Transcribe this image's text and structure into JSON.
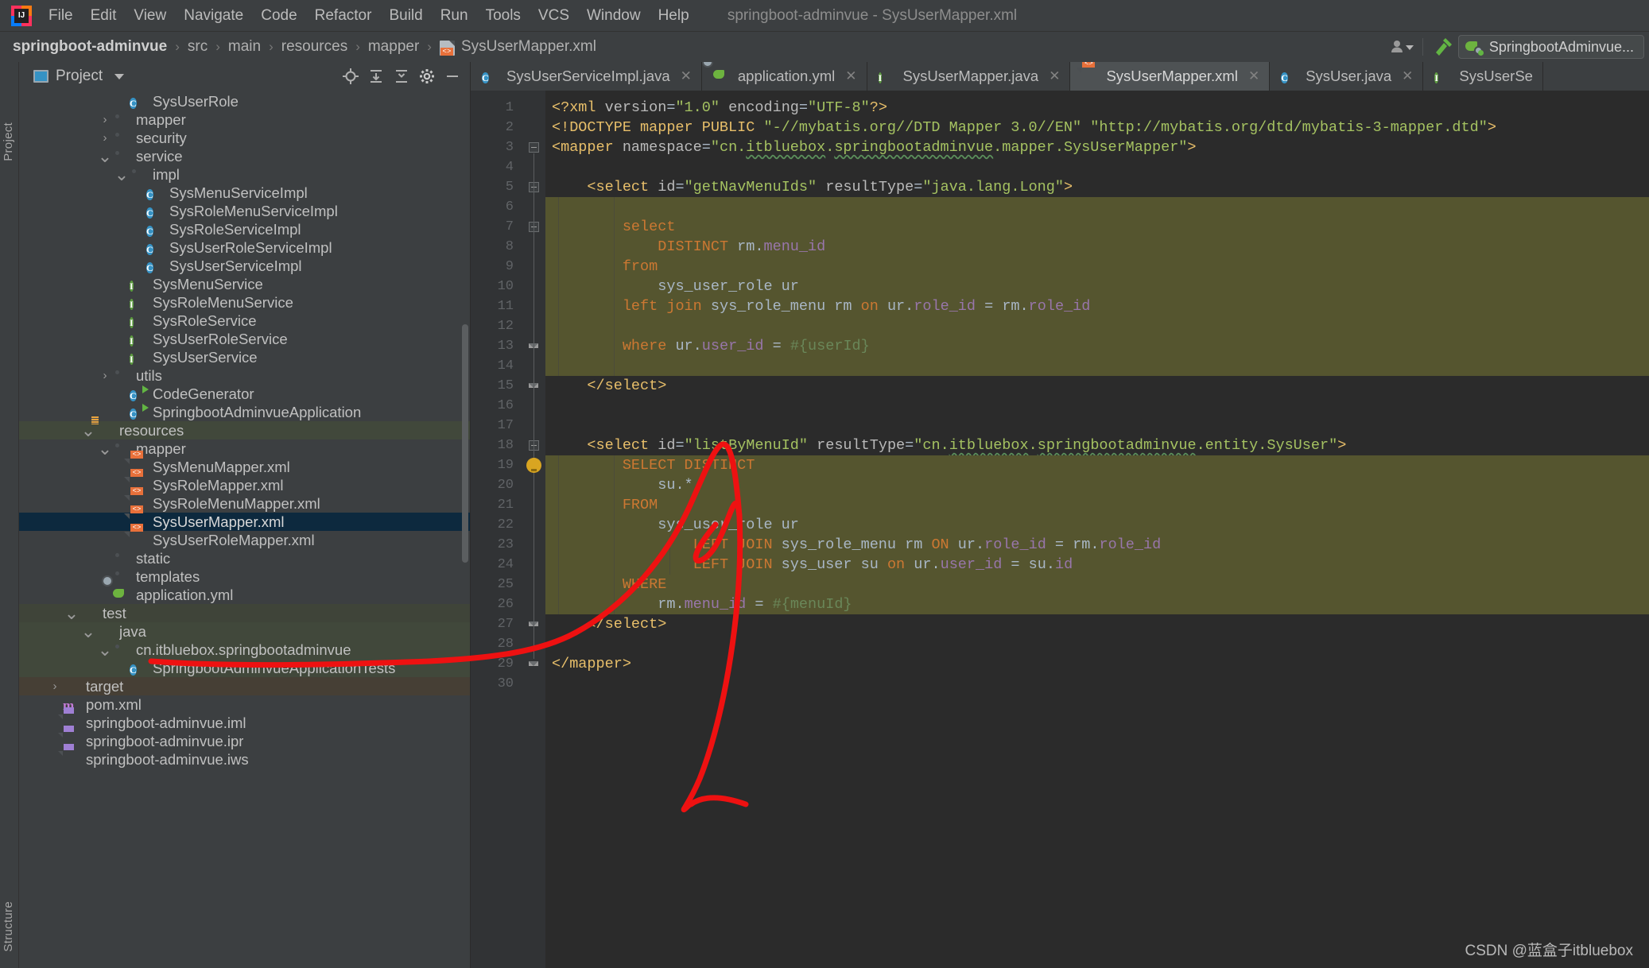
{
  "window": {
    "title": "springboot-adminvue - SysUserMapper.xml"
  },
  "menubar": {
    "items": [
      {
        "label": "File"
      },
      {
        "label": "Edit"
      },
      {
        "label": "View"
      },
      {
        "label": "Navigate"
      },
      {
        "label": "Code"
      },
      {
        "label": "Refactor"
      },
      {
        "label": "Build"
      },
      {
        "label": "Run"
      },
      {
        "label": "Tools"
      },
      {
        "label": "VCS"
      },
      {
        "label": "Window"
      },
      {
        "label": "Help"
      }
    ]
  },
  "navbar": {
    "crumbs": [
      "springboot-adminvue",
      "src",
      "main",
      "resources",
      "mapper",
      "SysUserMapper.xml"
    ],
    "separator": "›",
    "run_config": "SpringbootAdminvue...",
    "icons": [
      "user-dropdown-icon",
      "build-hammer-icon"
    ]
  },
  "sidebar": {
    "tool_windows": [
      "Project",
      "Structure"
    ],
    "panel_title": "Project",
    "toolbar_icons": [
      "locate-icon",
      "expand-all-icon",
      "collapse-all-icon",
      "settings-gear-icon",
      "hide-icon"
    ],
    "tree": [
      {
        "label": "SysUserRole",
        "icon": "class-icon",
        "indent": 5,
        "arrow": "none"
      },
      {
        "label": "mapper",
        "icon": "folder-icon",
        "indent": 4,
        "arrow": "collapsed"
      },
      {
        "label": "security",
        "icon": "folder-icon",
        "indent": 4,
        "arrow": "collapsed"
      },
      {
        "label": "service",
        "icon": "folder-icon",
        "indent": 4,
        "arrow": "expanded"
      },
      {
        "label": "impl",
        "icon": "folder-icon",
        "indent": 5,
        "arrow": "expanded"
      },
      {
        "label": "SysMenuServiceImpl",
        "icon": "class-icon",
        "indent": 6,
        "arrow": "none"
      },
      {
        "label": "SysRoleMenuServiceImpl",
        "icon": "class-icon",
        "indent": 6,
        "arrow": "none"
      },
      {
        "label": "SysRoleServiceImpl",
        "icon": "class-icon",
        "indent": 6,
        "arrow": "none"
      },
      {
        "label": "SysUserRoleServiceImpl",
        "icon": "class-icon",
        "indent": 6,
        "arrow": "none"
      },
      {
        "label": "SysUserServiceImpl",
        "icon": "class-icon",
        "indent": 6,
        "arrow": "none"
      },
      {
        "label": "SysMenuService",
        "icon": "interface-icon",
        "indent": 5,
        "arrow": "none"
      },
      {
        "label": "SysRoleMenuService",
        "icon": "interface-icon",
        "indent": 5,
        "arrow": "none"
      },
      {
        "label": "SysRoleService",
        "icon": "interface-icon",
        "indent": 5,
        "arrow": "none"
      },
      {
        "label": "SysUserRoleService",
        "icon": "interface-icon",
        "indent": 5,
        "arrow": "none"
      },
      {
        "label": "SysUserService",
        "icon": "interface-icon",
        "indent": 5,
        "arrow": "none"
      },
      {
        "label": "utils",
        "icon": "folder-icon",
        "indent": 4,
        "arrow": "collapsed"
      },
      {
        "label": "CodeGenerator",
        "icon": "runnable-class-icon",
        "indent": 5,
        "arrow": "none"
      },
      {
        "label": "SpringbootAdminvueApplication",
        "icon": "spring-class-icon",
        "indent": 5,
        "arrow": "none"
      },
      {
        "label": "resources",
        "icon": "resources-folder-icon",
        "indent": 3,
        "arrow": "expanded"
      },
      {
        "label": "mapper",
        "icon": "folder-icon",
        "indent": 4,
        "arrow": "expanded"
      },
      {
        "label": "SysMenuMapper.xml",
        "icon": "xml-icon",
        "indent": 5,
        "arrow": "none"
      },
      {
        "label": "SysRoleMapper.xml",
        "icon": "xml-icon",
        "indent": 5,
        "arrow": "none"
      },
      {
        "label": "SysRoleMenuMapper.xml",
        "icon": "xml-icon",
        "indent": 5,
        "arrow": "none"
      },
      {
        "label": "SysUserMapper.xml",
        "icon": "xml-icon",
        "indent": 5,
        "arrow": "none",
        "selected": true
      },
      {
        "label": "SysUserRoleMapper.xml",
        "icon": "xml-icon",
        "indent": 5,
        "arrow": "none"
      },
      {
        "label": "static",
        "icon": "folder-icon",
        "indent": 4,
        "arrow": "none"
      },
      {
        "label": "templates",
        "icon": "folder-icon",
        "indent": 4,
        "arrow": "none"
      },
      {
        "label": "application.yml",
        "icon": "yml-icon",
        "indent": 4,
        "arrow": "none"
      },
      {
        "label": "test",
        "icon": "test-folder-icon",
        "indent": 2,
        "arrow": "expanded"
      },
      {
        "label": "java",
        "icon": "test-src-folder-icon",
        "indent": 3,
        "arrow": "expanded"
      },
      {
        "label": "cn.itbluebox.springbootadminvue",
        "icon": "package-icon",
        "indent": 4,
        "arrow": "expanded"
      },
      {
        "label": "SpringbootAdminvueApplicationTests",
        "icon": "test-class-icon",
        "indent": 5,
        "arrow": "none"
      },
      {
        "label": "target",
        "icon": "target-folder-icon",
        "indent": 1,
        "arrow": "collapsed"
      },
      {
        "label": "pom.xml",
        "icon": "maven-icon",
        "indent": 1,
        "arrow": "none"
      },
      {
        "label": "springboot-adminvue.iml",
        "icon": "module-icon",
        "indent": 1,
        "arrow": "none"
      },
      {
        "label": "springboot-adminvue.ipr",
        "icon": "module-icon",
        "indent": 1,
        "arrow": "none"
      },
      {
        "label": "springboot-adminvue.iws",
        "icon": "module-icon",
        "indent": 1,
        "arrow": "none"
      }
    ]
  },
  "editor": {
    "tabs": [
      {
        "label": "SysUserServiceImpl.java",
        "icon": "class-icon",
        "active": false,
        "closable": true
      },
      {
        "label": "application.yml",
        "icon": "yml-icon",
        "active": false,
        "closable": true
      },
      {
        "label": "SysUserMapper.java",
        "icon": "interface-icon",
        "active": false,
        "closable": true
      },
      {
        "label": "SysUserMapper.xml",
        "icon": "xml-icon",
        "active": true,
        "closable": true
      },
      {
        "label": "SysUser.java",
        "icon": "class-icon",
        "active": false,
        "closable": true
      },
      {
        "label": "SysUserSe",
        "icon": "interface-icon",
        "active": false,
        "closable": false
      }
    ],
    "line_numbers": [
      1,
      2,
      3,
      4,
      5,
      6,
      7,
      8,
      9,
      10,
      11,
      12,
      13,
      14,
      15,
      16,
      17,
      18,
      19,
      20,
      21,
      22,
      23,
      24,
      25,
      26,
      27,
      28,
      29,
      30
    ],
    "code": [
      {
        "n": 1,
        "inj": false,
        "html": "<span class=\"t-tag\">&lt;?xml</span> <span class=\"t-attr\">version</span><span class=\"t-punc\">=</span><span class=\"t-val\">\"1.0\"</span> <span class=\"t-attr\">encoding</span><span class=\"t-punc\">=</span><span class=\"t-val\">\"UTF-8\"</span><span class=\"t-tag\">?&gt;</span>"
      },
      {
        "n": 2,
        "inj": false,
        "html": "<span class=\"t-doctype\">&lt;!DOCTYPE mapper PUBLIC </span><span class=\"t-val\">\"-//mybatis.org//DTD Mapper 3.0//EN\"</span> <span class=\"t-val\">\"http://mybatis.org/dtd/mybatis-3-mapper.dtd\"</span><span class=\"t-doctype\">&gt;</span>"
      },
      {
        "n": 3,
        "inj": false,
        "html": "<span class=\"t-tag\">&lt;mapper</span> <span class=\"t-attr\">namespace</span><span class=\"t-punc\">=</span><span class=\"t-val\">\"cn.<u class=\"u-green-wavy\">itbluebox</u>.<u class=\"u-green-wavy\">springbootadminvue</u>.mapper.SysUserMapper\"</span><span class=\"t-tag\">&gt;</span>"
      },
      {
        "n": 4,
        "inj": false,
        "html": ""
      },
      {
        "n": 5,
        "inj": false,
        "html": "    <span class=\"t-tag\">&lt;select</span> <span class=\"t-attr\">id</span><span class=\"t-punc\">=</span><span class=\"t-val\">\"getNavMenuIds\"</span> <span class=\"t-attr\">resultType</span><span class=\"t-punc\">=</span><span class=\"t-val\">\"java.lang.Long\"</span><span class=\"t-tag\">&gt;</span>"
      },
      {
        "n": 6,
        "inj": true,
        "html": ""
      },
      {
        "n": 7,
        "inj": true,
        "html": "        <span class=\"t-kw\">select</span>"
      },
      {
        "n": 8,
        "inj": true,
        "html": "            <span class=\"t-kw\">DISTINCT</span> <span class=\"t-id\">rm</span><span class=\"t-punc\">.</span><span class=\"t-col\">menu_id</span>"
      },
      {
        "n": 9,
        "inj": true,
        "html": "        <span class=\"t-kw\">from</span>"
      },
      {
        "n": 10,
        "inj": true,
        "html": "            <span class=\"t-id\">sys_user_role</span> <span class=\"t-id\">ur</span>"
      },
      {
        "n": 11,
        "inj": true,
        "html": "        <span class=\"t-kw\">left join</span> <span class=\"t-id\">sys_role_menu</span> <span class=\"t-id\">rm</span> <span class=\"t-kw\">on</span> <span class=\"t-id\">ur</span><span class=\"t-punc\">.</span><span class=\"t-col\">role_id</span> <span class=\"t-punc\">=</span> <span class=\"t-id\">rm</span><span class=\"t-punc\">.</span><span class=\"t-col\">role_id</span>"
      },
      {
        "n": 12,
        "inj": true,
        "html": ""
      },
      {
        "n": 13,
        "inj": true,
        "html": "        <span class=\"t-kw\">where</span> <span class=\"t-id\">ur</span><span class=\"t-punc\">.</span><span class=\"t-col\">user_id</span> <span class=\"t-punc\">=</span> <span class=\"t-param\">#{userId}</span>"
      },
      {
        "n": 14,
        "inj": true,
        "html": ""
      },
      {
        "n": 15,
        "inj": false,
        "html": "    <span class=\"t-tag\">&lt;/select&gt;</span>"
      },
      {
        "n": 16,
        "inj": false,
        "html": ""
      },
      {
        "n": 17,
        "inj": false,
        "html": ""
      },
      {
        "n": 18,
        "inj": false,
        "html": "    <span class=\"t-tag\">&lt;select</span> <span class=\"t-attr\">id</span><span class=\"t-punc\">=</span><span class=\"t-val\">\"listByMenuId\"</span> <span class=\"t-attr\">resultType</span><span class=\"t-punc\">=</span><span class=\"t-val\">\"cn.<u class=\"u-green-wavy\">itbluebox</u>.<u class=\"u-green-wavy\">springbootadminvue</u>.entity.SysUser\"</span><span class=\"t-tag\">&gt;</span>"
      },
      {
        "n": 19,
        "inj": true,
        "html": "        <span class=\"t-kw\">SELECT DISTINCT</span>"
      },
      {
        "n": 20,
        "inj": true,
        "html": "            <span class=\"t-id\">su</span><span class=\"t-punc\">.*</span>"
      },
      {
        "n": 21,
        "inj": true,
        "html": "        <span class=\"t-kw\">FROM</span>"
      },
      {
        "n": 22,
        "inj": true,
        "html": "            <span class=\"t-id\">sys_user_role</span> <span class=\"t-id\">ur</span>"
      },
      {
        "n": 23,
        "inj": true,
        "html": "                <span class=\"t-kw\">LEFT JOIN</span> <span class=\"t-id\">sys_role_menu</span> <span class=\"t-id\">rm</span> <span class=\"t-kw\">ON</span> <span class=\"t-id\">ur</span><span class=\"t-punc\">.</span><span class=\"t-col\">role_id</span> <span class=\"t-punc\">=</span> <span class=\"t-id\">rm</span><span class=\"t-punc\">.</span><span class=\"t-col\">role_id</span>"
      },
      {
        "n": 24,
        "inj": true,
        "html": "                <span class=\"t-kw\">LEFT JOIN</span> <span class=\"t-id\">sys_user</span> <span class=\"t-id\">su</span> <span class=\"t-kw\">on</span> <span class=\"t-id\">ur</span><span class=\"t-punc\">.</span><span class=\"t-col\">user_id</span> <span class=\"t-punc\">=</span> <span class=\"t-id\">su</span><span class=\"t-punc\">.</span><span class=\"t-col\">id</span>"
      },
      {
        "n": 25,
        "inj": true,
        "html": "        <span class=\"t-kw\">WHERE</span>"
      },
      {
        "n": 26,
        "inj": true,
        "html": "            <span class=\"t-id\">rm</span><span class=\"t-punc\">.</span><span class=\"t-col\">menu_id</span> <span class=\"t-punc\">=</span> <span class=\"t-param\">#{menuId}</span>"
      },
      {
        "n": 27,
        "inj": false,
        "html": "    <span class=\"t-tag\">&lt;/select&gt;</span>"
      },
      {
        "n": 28,
        "inj": false,
        "html": ""
      },
      {
        "n": 29,
        "inj": false,
        "html": "<span class=\"t-tag\">&lt;/mapper&gt;</span>"
      },
      {
        "n": 30,
        "inj": false,
        "html": ""
      }
    ]
  },
  "annotation": {
    "color": "#ee1111",
    "shape": "hand-drawn-arrow-underline"
  },
  "watermark": {
    "text": "CSDN @蓝盒子itbluebox"
  }
}
